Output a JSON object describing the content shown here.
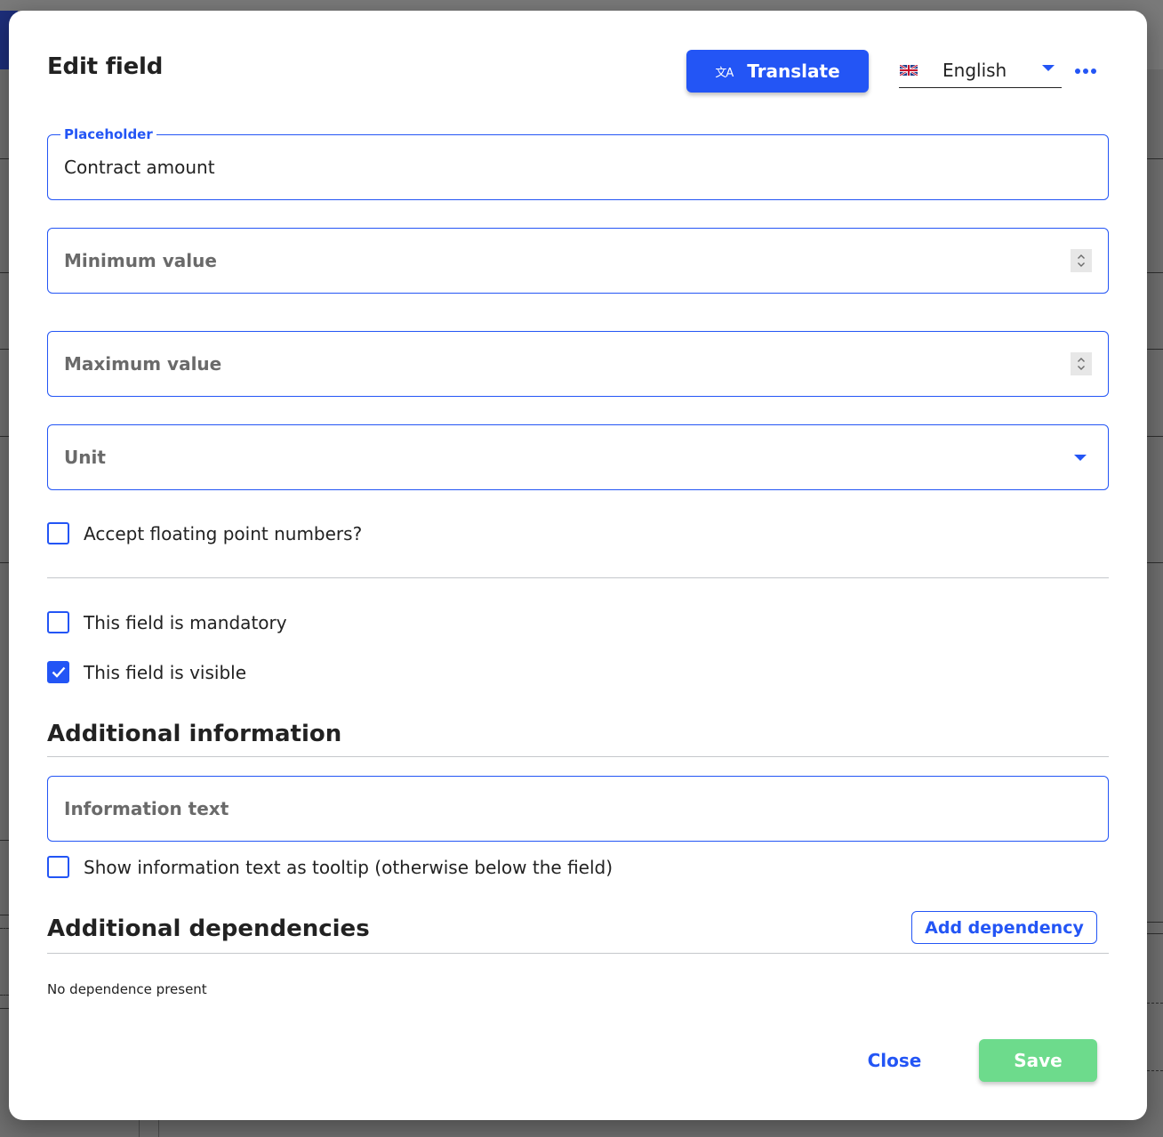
{
  "dialog": {
    "title": "Edit field",
    "translate_button": "Translate",
    "translate_icon": "translate-icon",
    "language": {
      "selected": "English",
      "flag": "uk-flag-icon"
    },
    "more_icon": "more-horizontal-icon"
  },
  "fields": {
    "placeholder": {
      "label": "Placeholder",
      "value": "Contract amount"
    },
    "minimum_value": {
      "placeholder": "Minimum value",
      "value": ""
    },
    "maximum_value": {
      "placeholder": "Maximum value",
      "value": ""
    },
    "unit": {
      "placeholder": "Unit",
      "value": ""
    }
  },
  "checkboxes": {
    "floating_point": {
      "label": "Accept floating point numbers?",
      "checked": false
    },
    "mandatory": {
      "label": "This field is mandatory",
      "checked": false
    },
    "visible": {
      "label": "This field is visible",
      "checked": true
    },
    "tooltip": {
      "label": "Show information text as tooltip (otherwise below the field)",
      "checked": false
    }
  },
  "additional_information": {
    "heading": "Additional information",
    "info_text_placeholder": "Information text"
  },
  "additional_dependencies": {
    "heading": "Additional dependencies",
    "add_button": "Add dependency",
    "empty_text": "No dependence present"
  },
  "footer": {
    "close_button": "Close",
    "save_button": "Save"
  },
  "colors": {
    "accent": "#2355f5",
    "save": "#6ddb8c",
    "overlay": "#6f6f6f"
  }
}
